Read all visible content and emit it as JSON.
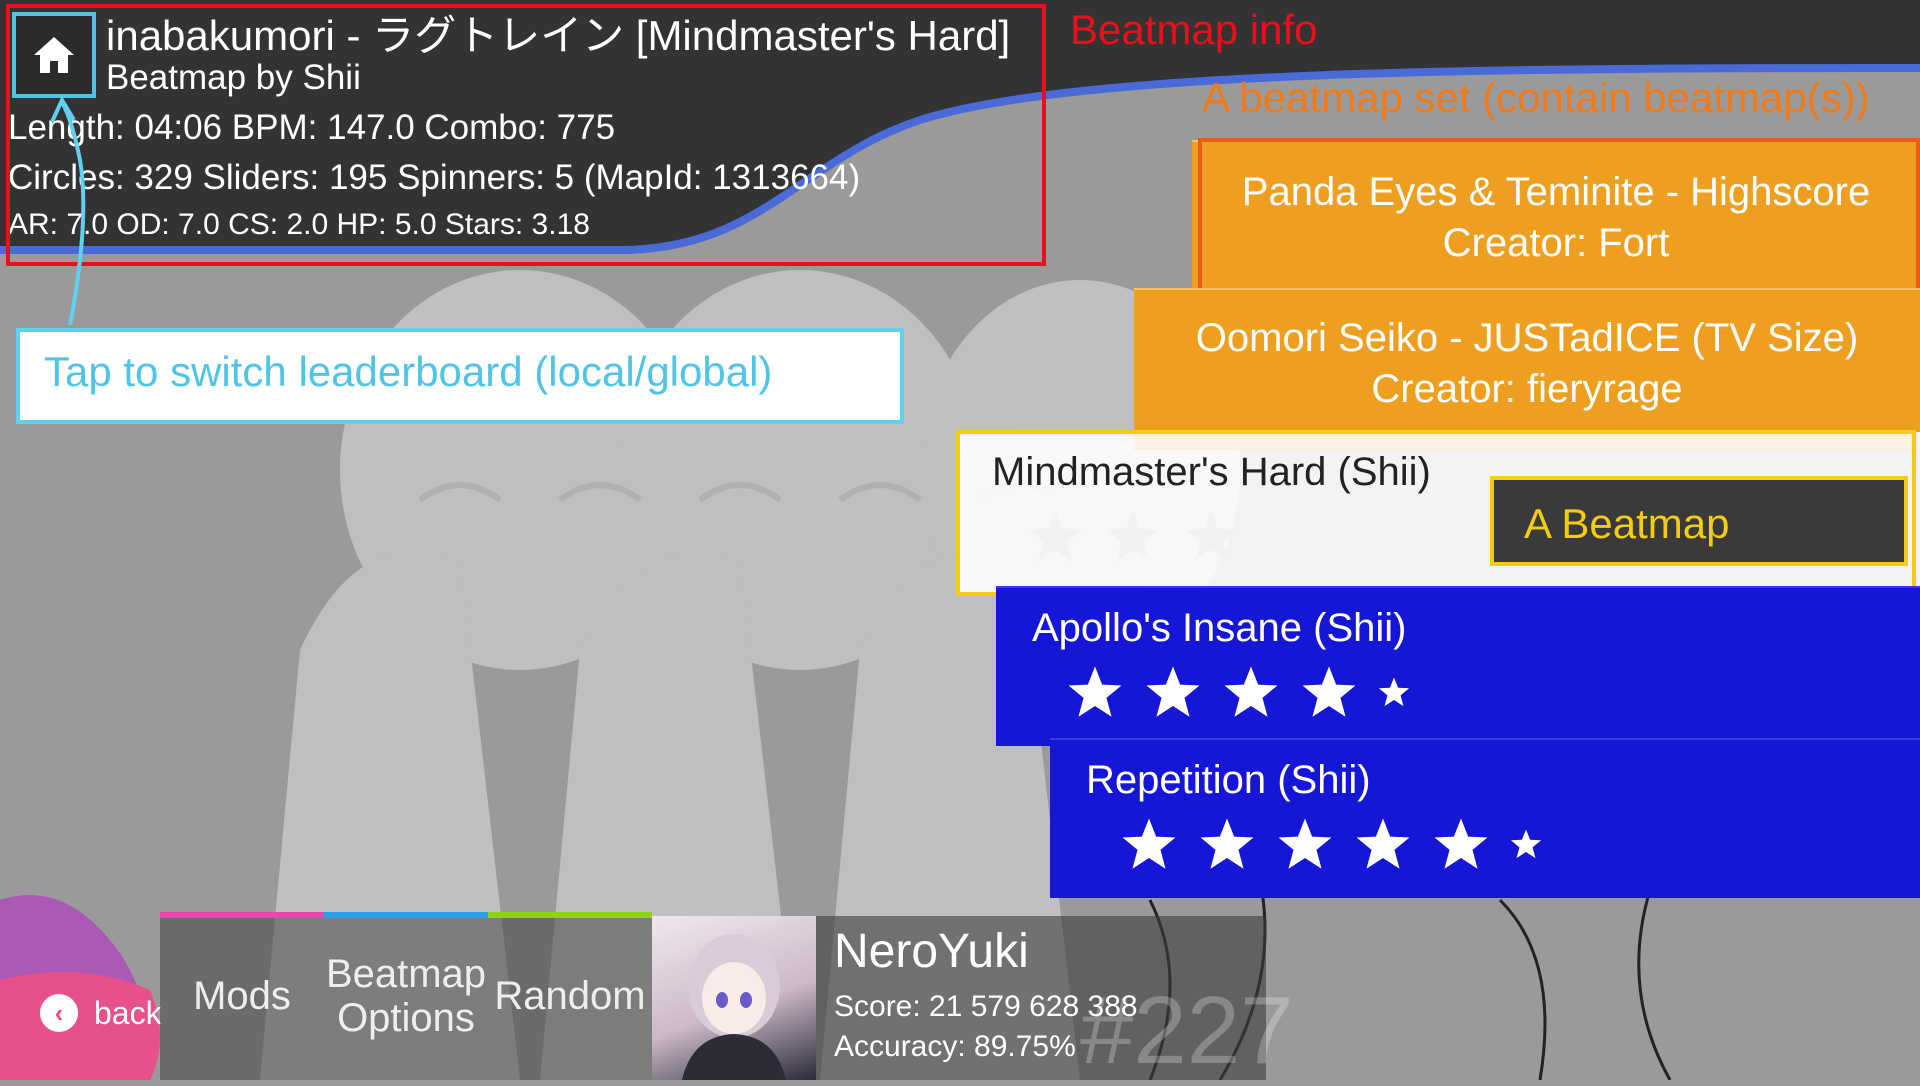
{
  "beatmap_info": {
    "title": "inabakumori - ラグトレイン [Mindmaster's Hard]",
    "creator": "Beatmap by Shii",
    "line1": "Length: 04:06 BPM: 147.0 Combo: 775",
    "line2": "Circles: 329 Sliders: 195 Spinners: 5 (MapId: 1313664)",
    "line3": "AR: 7.0 OD: 7.0 CS: 2.0 HP: 5.0 Stars: 3.18",
    "home_icon": "home-icon"
  },
  "annotations": {
    "beatmap_info": "Beatmap info",
    "beatmap_set": "A beatmap set (contain beatmap(s))",
    "tap_switch": "Tap to switch leaderboard (local/global)",
    "a_beatmap": "A Beatmap"
  },
  "beatmap_sets": [
    {
      "title": "Panda Eyes & Teminite - Highscore",
      "creator": "Creator: Fort"
    },
    {
      "title": "Oomori Seiko - JUSTadICE (TV Size)",
      "creator": "Creator: fieryrage"
    }
  ],
  "difficulties": [
    {
      "name": "Mindmaster's Hard (Shii)",
      "stars": 3.18,
      "selected": true
    },
    {
      "name": "Apollo's Insane (Shii)",
      "stars": 4.5,
      "selected": false
    },
    {
      "name": "Repetition (Shii)",
      "stars": 5.5,
      "selected": false
    }
  ],
  "bottom_bar": {
    "back": "back",
    "mods": "Mods",
    "beatmap_options": "Beatmap Options",
    "random": "Random"
  },
  "profile": {
    "username": "NeroYuki",
    "score": "Score: 21 579 628 388",
    "accuracy": "Accuracy: 89.75%",
    "rank": "#227"
  },
  "colors": {
    "set_card": "#ef9f20",
    "diff_blue": "#1616d6",
    "annot_red": "#e8101a",
    "annot_orange": "#f07a18",
    "annot_cyan": "#4fc3e8",
    "annot_yellow": "#f4cc14",
    "mods_bar": "#e04aa8",
    "options_bar": "#2aa0e8",
    "random_bar": "#8cd020"
  }
}
